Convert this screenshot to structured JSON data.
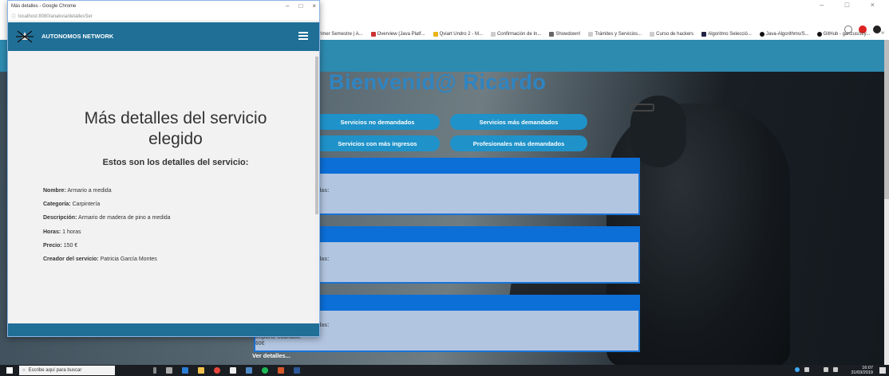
{
  "popup": {
    "window_title": "Más detalles - Google Chrome",
    "url": "localhost:8080/anakvia/detallesSer",
    "brand": "AUTONOMOS NETWORK",
    "heading": "Más detalles del servicio elegido",
    "subheading": "Estos son los detalles del servicio:",
    "details": [
      {
        "label": "Nombre:",
        "value": "Armario a medida"
      },
      {
        "label": "Categoría:",
        "value": "Carpintería"
      },
      {
        "label": "Descripción:",
        "value": "Armario de madera de pino a medida"
      },
      {
        "label": "Horas:",
        "value": "1 horas"
      },
      {
        "label": "Precio:",
        "value": "150 €"
      },
      {
        "label": "Creador del servicio:",
        "value": "Patricia García Montes"
      }
    ]
  },
  "background": {
    "bookmarks": [
      "rimer Semestre | A...",
      "Overview (Java Platf...",
      "Qviart Undro 2 - M...",
      "Confirmación de In...",
      "Showdown!",
      "Trámites y Servicios...",
      "Curso de hackers",
      "Algoritmo Selecció...",
      "Java-Algorithms/S...",
      "GitHub - ganzus/scy..."
    ],
    "welcome": "Bienvenid@ Ricardo",
    "buttons": [
      "Servicios no demandados",
      "Servicios más demandados",
      "Servicios con más ingresos",
      "Profesionales más demandados"
    ],
    "card_fragment_1": "etadas:",
    "card_fragment_2": "etadas:",
    "card_fragment_3a": "co",
    "card_fragment_3b": "etadas:",
    "card3_importe_label": "Importe cobrado:",
    "card3_importe_value": "60€",
    "ver_detalles": "Ver detalles..."
  },
  "taskbar": {
    "search_placeholder": "Escribe aquí para buscar",
    "time": "16:07",
    "date": "31/03/2019"
  },
  "colors": {
    "nav_blue": "#1f6f97",
    "accent_blue": "#1f92c9",
    "card_header": "#0c6fd8",
    "card_body": "#b2c5e0",
    "welcome_text": "#2e85c2"
  }
}
